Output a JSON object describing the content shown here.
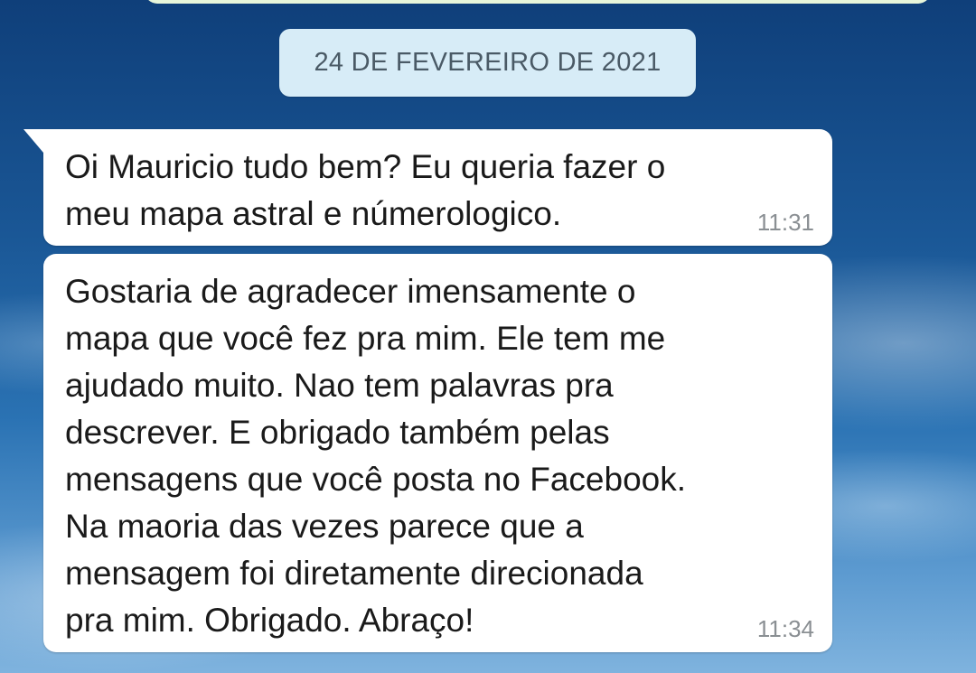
{
  "chat": {
    "date_separator": "24 DE FEVEREIRO DE 2021",
    "messages": [
      {
        "text": "Oi Mauricio tudo bem? Eu queria fazer o\nmeu mapa astral e númerologico.",
        "time": "11:31"
      },
      {
        "text": "Gostaria de agradecer imensamente o\nmapa que você fez pra mim. Ele tem me\najudado muito. Nao tem palavras pra\ndescrever. E obrigado também pelas\nmensagens que você posta no Facebook.\nNa maoria das vezes parece que a\nmensagem foi diretamente direcionada\npra mim. Obrigado. Abraço!",
        "time": "11:34"
      }
    ]
  },
  "colors": {
    "bubble_incoming": "#ffffff",
    "date_chip": "#d7ecf7",
    "timestamp": "#8a8f93",
    "wallpaper": "#1a5796"
  }
}
